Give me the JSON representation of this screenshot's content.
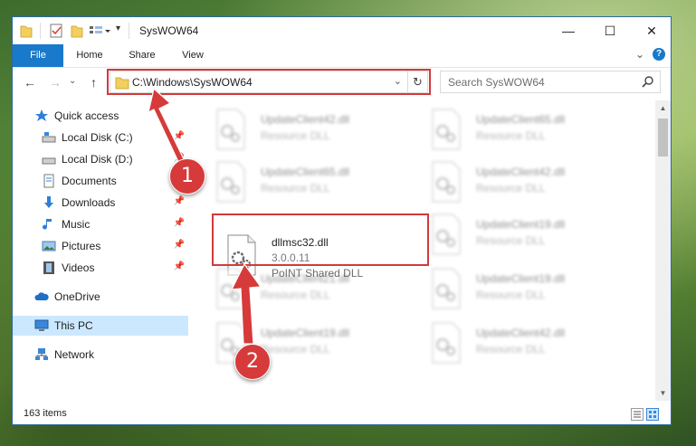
{
  "window": {
    "title": "SysWOW64",
    "controls": {
      "minimize": "—",
      "maximize": "☐",
      "close": "✕"
    },
    "ribbon_expand": "⌄",
    "help": "?"
  },
  "ribbon": {
    "tabs": [
      "File",
      "Home",
      "Share",
      "View"
    ]
  },
  "address": {
    "path": "C:\\Windows\\SysWOW64",
    "dropdown": "⌄",
    "refresh": "↻",
    "search_placeholder": "Search SysWOW64"
  },
  "nav": {
    "back": "←",
    "forward": "→",
    "recent": "⌄",
    "up": "↑"
  },
  "sidebar": {
    "items": [
      {
        "label": "Quick access",
        "pin": ""
      },
      {
        "label": "Local Disk (C:)",
        "pin": "📌"
      },
      {
        "label": "Local Disk (D:)",
        "pin": "📌"
      },
      {
        "label": "Documents",
        "pin": "📌"
      },
      {
        "label": "Downloads",
        "pin": "📌"
      },
      {
        "label": "Music",
        "pin": "📌"
      },
      {
        "label": "Pictures",
        "pin": "📌"
      },
      {
        "label": "Videos",
        "pin": "📌"
      },
      {
        "label": "OneDrive",
        "pin": ""
      },
      {
        "label": "This PC",
        "pin": ""
      },
      {
        "label": "Network",
        "pin": ""
      }
    ]
  },
  "files": {
    "blurred": [
      {
        "name": "UpdateClient42.dll",
        "desc": "Resource DLL"
      },
      {
        "name": "UpdateClient65.dll",
        "desc": "Resource DLL"
      },
      {
        "name": "UpdateClient65.dll",
        "desc": "Resource DLL"
      },
      {
        "name": "UpdateClient42.dll",
        "desc": "Resource DLL"
      },
      {
        "name": "UpdateClient19.dll",
        "desc": "Resource DLL"
      },
      {
        "name": "UpdateClient21.dll",
        "desc": "Resource DLL"
      },
      {
        "name": "UpdateClient19.dll",
        "desc": "Resource DLL"
      },
      {
        "name": "UpdateClient19.dll",
        "desc": "Resource DLL"
      },
      {
        "name": "UpdateClient42.dll",
        "desc": "Resource DLL"
      }
    ],
    "selected": {
      "name": "dllmsc32.dll",
      "version": "3.0.0.11",
      "desc": "PoINT Shared DLL"
    }
  },
  "status": {
    "count": "163 items"
  },
  "scrollbar": {
    "up": "▲",
    "down": "▼"
  },
  "callouts": [
    "1",
    "2"
  ],
  "colors": {
    "accent": "#1979ca",
    "highlight": "#d23a3a",
    "selection": "#cce8ff"
  }
}
